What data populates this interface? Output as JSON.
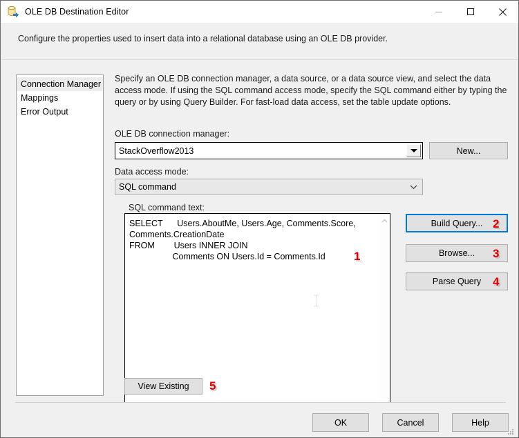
{
  "window": {
    "title": "OLE DB Destination Editor",
    "icon": "database-destination-icon",
    "controls": {
      "minimize": "minimize-icon",
      "maximize": "maximize-icon",
      "close": "close-icon"
    }
  },
  "header": {
    "description": "Configure the properties used to insert data into a relational database using an OLE DB provider."
  },
  "sidebar": {
    "items": [
      {
        "label": "Connection Manager",
        "selected": true
      },
      {
        "label": "Mappings",
        "selected": false
      },
      {
        "label": "Error Output",
        "selected": false
      }
    ]
  },
  "pane": {
    "description": "Specify an OLE DB connection manager, a data source, or a data source view, and select the data access mode. If using the SQL command access mode, specify the SQL command either by typing the query or by using Query Builder. For fast-load data access, set the table update options.",
    "connection_manager": {
      "label": "OLE DB connection manager:",
      "value": "StackOverflow2013",
      "arrow_icon": "chevron-down-icon"
    },
    "new_button": "New...",
    "data_access_mode": {
      "label": "Data access mode:",
      "value": "SQL command",
      "arrow_icon": "chevron-down-icon"
    },
    "sql_command": {
      "label": "SQL command text:",
      "value": "SELECT      Users.AboutMe, Users.Age, Comments.Score,\nComments.CreationDate\nFROM        Users INNER JOIN\n                  Comments ON Users.Id = Comments.Id",
      "scroll_up_icon": "chevron-up-icon",
      "scroll_down_icon": "chevron-down-icon"
    },
    "build_query_button": "Build Query...",
    "browse_button": "Browse...",
    "parse_query_button": "Parse Query",
    "view_existing_button": "View Existing"
  },
  "footer": {
    "ok_button": "OK",
    "cancel_button": "Cancel",
    "help_button": "Help",
    "grip": "resize-grip-icon"
  },
  "annotations": [
    {
      "number": "1"
    },
    {
      "number": "2"
    },
    {
      "number": "3"
    },
    {
      "number": "4"
    },
    {
      "number": "5"
    }
  ],
  "colors": {
    "accent": "#0078d7",
    "annotation": "#e00000",
    "dialog_bg": "#f0f0f0",
    "button_bg": "#e1e1e1"
  }
}
